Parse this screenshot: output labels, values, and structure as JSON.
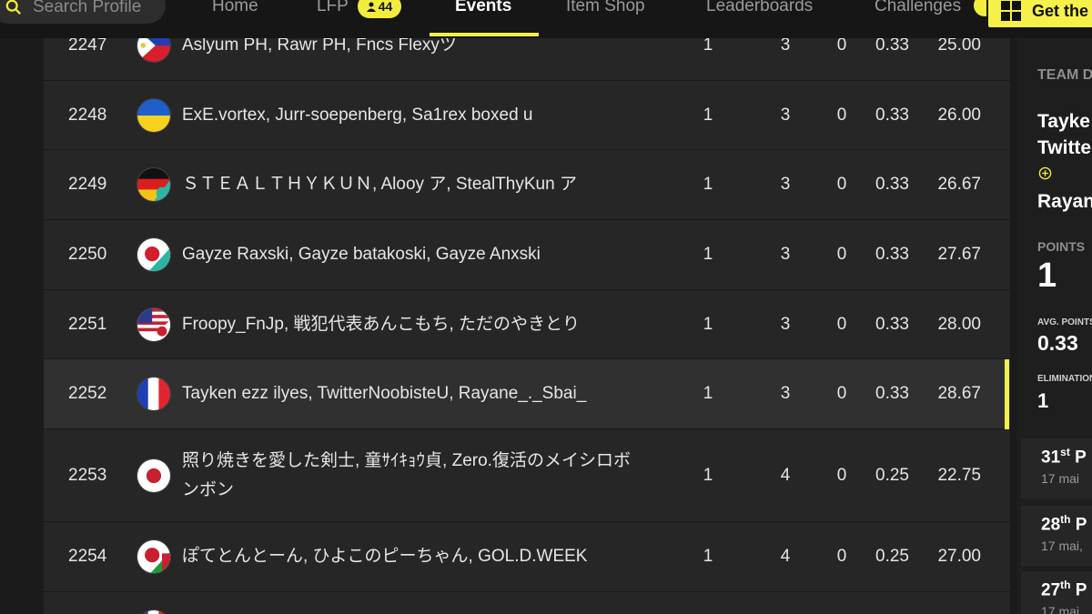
{
  "nav": {
    "search_placeholder": "Search Profile",
    "items": [
      {
        "label": "Home",
        "active": false
      },
      {
        "label": "LFP",
        "active": false
      },
      {
        "label": "Events",
        "active": true
      },
      {
        "label": "Item Shop",
        "active": false
      },
      {
        "label": "Leaderboards",
        "active": false
      },
      {
        "label": "Challenges",
        "active": false
      }
    ],
    "lfp_count": "44",
    "get_button": "Get the"
  },
  "rows": [
    {
      "rank": "2247",
      "names": "Aslyum PH, Rawr PH, Fncs Flexyツ",
      "flag": "philippines-flag",
      "c1": "1",
      "c2": "3",
      "c3": "0",
      "c4": "0.33",
      "c5": "25.00"
    },
    {
      "rank": "2248",
      "names": "ExE.vortex, Jurr-soepenberg, Sa1rex boxed u",
      "flag": "ukraine-flag",
      "c1": "1",
      "c2": "3",
      "c3": "0",
      "c4": "0.33",
      "c5": "26.00"
    },
    {
      "rank": "2249",
      "names": "ＳＴＥＡＬＴＨＹＫＵＮ, Alooy ア, StealThyKun ア",
      "flag": "germany-mixed-flag",
      "c1": "1",
      "c2": "3",
      "c3": "0",
      "c4": "0.33",
      "c5": "26.67"
    },
    {
      "rank": "2250",
      "names": "Gayze Raxski, Gayze batakoski, Gayze Anxski",
      "flag": "japan-mixed-flag",
      "c1": "1",
      "c2": "3",
      "c3": "0",
      "c4": "0.33",
      "c5": "27.67"
    },
    {
      "rank": "2251",
      "names": "Froopy_FnJp, 戦犯代表あんこもち, ただのやきとり",
      "flag": "usa-japan-flag",
      "c1": "1",
      "c2": "3",
      "c3": "0",
      "c4": "0.33",
      "c5": "28.00"
    },
    {
      "rank": "2252",
      "names": "Tayken ezz ilyes, TwitterNoobisteU, Rayane_._Sbai_",
      "flag": "france-flag",
      "c1": "1",
      "c2": "3",
      "c3": "0",
      "c4": "0.33",
      "c5": "28.67"
    },
    {
      "rank": "2253",
      "names": "照り焼きを愛した剣士, 童ｻｲｷｮｳ貞, Zero.復活のメイシロボンボン",
      "flag": "japan-flag",
      "c1": "1",
      "c2": "4",
      "c3": "0",
      "c4": "0.25",
      "c5": "22.75"
    },
    {
      "rank": "2254",
      "names": "ぽてとんとーん, ひよこのピーちゃん, GOL.D.WEEK",
      "flag": "japan-afghanistan-flag",
      "c1": "1",
      "c2": "4",
      "c3": "0",
      "c4": "0.25",
      "c5": "27.00"
    },
    {
      "rank": "",
      "names": "",
      "flag": "france-flag",
      "c1": "",
      "c2": "",
      "c3": "",
      "c4": "",
      "c5": ""
    }
  ],
  "panel": {
    "team_label": "TEAM D",
    "member1": "Tayke",
    "member2": "Twitte",
    "member3": "Rayan",
    "points_label": "POINTS",
    "points_value": "1",
    "avg_label": "AVG. POINTS",
    "avg_value": "0.33",
    "elim_label": "ELIMINATIONS",
    "elim_value": "1",
    "matches": [
      {
        "place_num": "31",
        "place_suffix": "st",
        "place_word": "P",
        "date": "17 mai"
      },
      {
        "place_num": "28",
        "place_suffix": "th",
        "place_word": "P",
        "date": "17 mai,"
      },
      {
        "place_num": "27",
        "place_suffix": "th",
        "place_word": "P",
        "date": "17 mai"
      }
    ]
  }
}
